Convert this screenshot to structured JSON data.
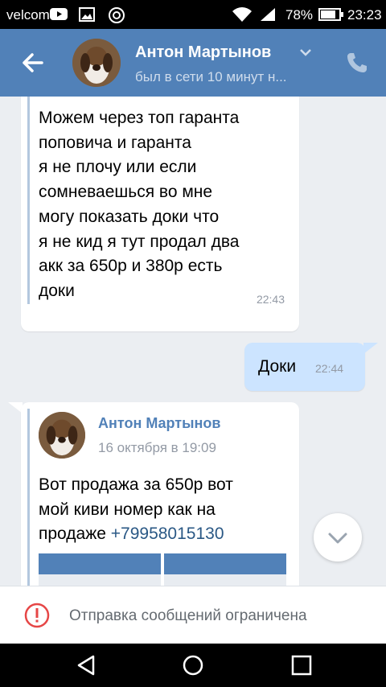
{
  "status_bar": {
    "carrier": "velcom",
    "battery_percent": "78%",
    "time": "23:23",
    "icons": [
      "youtube-icon",
      "image-icon",
      "vk-icon",
      "wifi-icon",
      "signal-icon",
      "battery-icon"
    ]
  },
  "header": {
    "contact_name": "Антон Мартынов",
    "status": "был в сети 10 минут н...",
    "accent_color": "#5181b8"
  },
  "messages": [
    {
      "direction": "incoming",
      "forwarded": true,
      "text_lines": [
        "Можем через топ гаранта",
        "поповича и гаранта",
        "я не плочу или если",
        "сомневаешься во мне",
        "могу показать доки что",
        "я не кид я тут продал два",
        "акк за 650р и 380р  есть",
        "доки"
      ],
      "time": "22:43"
    },
    {
      "direction": "outgoing",
      "text": "Доки",
      "time": "22:44"
    },
    {
      "direction": "incoming",
      "forwarded": true,
      "forward_author": "Антон Мартынов",
      "forward_date": "16 октября в 19:09",
      "text_lines": [
        "Вот продажа за 650р вот",
        "мой киви номер как на",
        "продаже "
      ],
      "phone": "+79958015130",
      "attachments": [
        "screenshot",
        "screenshot"
      ]
    }
  ],
  "restriction": {
    "text": "Отправка сообщений ограничена"
  },
  "colors": {
    "chat_bg": "#ebeef2",
    "outgoing_bubble": "#cce4ff",
    "incoming_bubble": "#ffffff",
    "link": "#2a5885",
    "restriction_icon": "#e64646"
  }
}
